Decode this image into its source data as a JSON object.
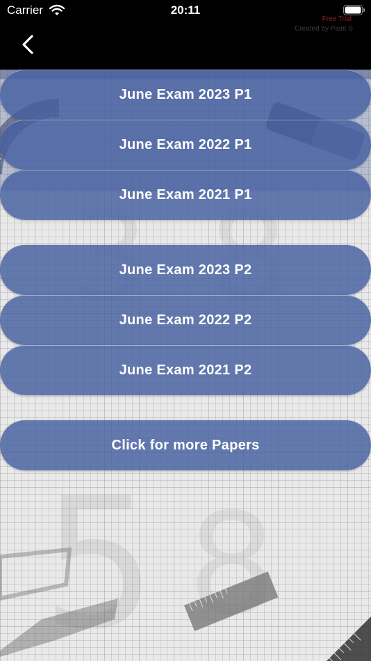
{
  "status_bar": {
    "carrier": "Carrier",
    "time": "20:11",
    "wifi_icon": "wifi-icon",
    "battery_icon": "battery-icon"
  },
  "nav_bar": {
    "back_icon": "chevron-left-icon",
    "watermark_line1": "Free Trial",
    "watermark_line2": "Created by Paint S"
  },
  "papers_p1": [
    {
      "label": "June Exam 2023 P1"
    },
    {
      "label": "June Exam 2022 P1"
    },
    {
      "label": "June Exam 2021 P1"
    }
  ],
  "papers_p2": [
    {
      "label": "June Exam 2023 P2"
    },
    {
      "label": "June Exam 2022 P2"
    },
    {
      "label": "June Exam 2021 P2"
    }
  ],
  "more": {
    "label": "Click for more Papers"
  },
  "colors": {
    "button_fill": "#465FA0",
    "button_text": "#FFFFFF",
    "top_bar": "#000000"
  }
}
